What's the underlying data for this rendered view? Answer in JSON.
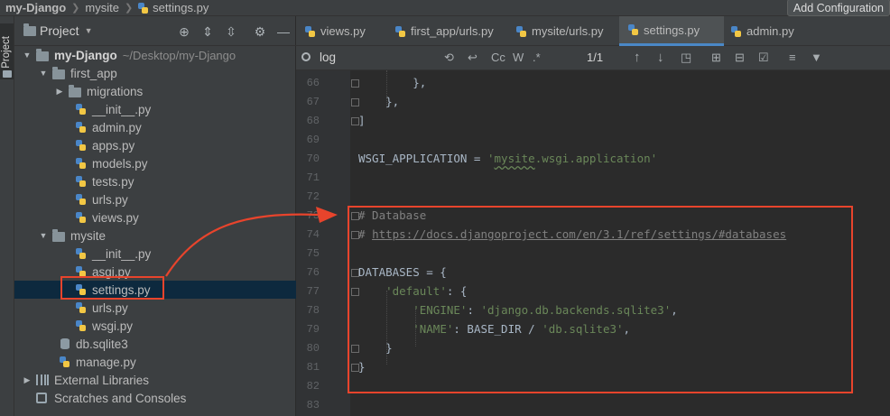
{
  "breadcrumbs": [
    {
      "label": "my-Django"
    },
    {
      "label": "mysite"
    },
    {
      "label": "settings.py"
    }
  ],
  "toolbar": {
    "add_configuration_label": "Add Configuration"
  },
  "tool_strip": {
    "project_label": "Project"
  },
  "project_panel": {
    "title": "Project",
    "root": {
      "name": "my-Django",
      "path": "~/Desktop/my-Django"
    },
    "tree": [
      {
        "label": "first_app",
        "kind": "folder",
        "depth": 1,
        "expanded": true
      },
      {
        "label": "migrations",
        "kind": "folder",
        "depth": 2,
        "expanded": false
      },
      {
        "label": "__init__.py",
        "kind": "py",
        "depth": 3
      },
      {
        "label": "admin.py",
        "kind": "py",
        "depth": 3
      },
      {
        "label": "apps.py",
        "kind": "py",
        "depth": 3
      },
      {
        "label": "models.py",
        "kind": "py",
        "depth": 3
      },
      {
        "label": "tests.py",
        "kind": "py",
        "depth": 3
      },
      {
        "label": "urls.py",
        "kind": "py",
        "depth": 3
      },
      {
        "label": "views.py",
        "kind": "py",
        "depth": 3
      },
      {
        "label": "mysite",
        "kind": "folder",
        "depth": 1,
        "expanded": true
      },
      {
        "label": "__init__.py",
        "kind": "py",
        "depth": 3
      },
      {
        "label": "asgi.py",
        "kind": "py",
        "depth": 3
      },
      {
        "label": "settings.py",
        "kind": "py",
        "depth": 3,
        "selected": true
      },
      {
        "label": "urls.py",
        "kind": "py",
        "depth": 3
      },
      {
        "label": "wsgi.py",
        "kind": "py",
        "depth": 3
      },
      {
        "label": "db.sqlite3",
        "kind": "db",
        "depth": 2
      },
      {
        "label": "manage.py",
        "kind": "py",
        "depth": 2
      },
      {
        "label": "External Libraries",
        "kind": "lib",
        "depth": 0,
        "expanded": false
      },
      {
        "label": "Scratches and Consoles",
        "kind": "scratch",
        "depth": 0
      }
    ]
  },
  "tabs": [
    {
      "label": "views.py"
    },
    {
      "label": "first_app/urls.py"
    },
    {
      "label": "mysite/urls.py"
    },
    {
      "label": "settings.py",
      "active": true
    },
    {
      "label": "admin.py"
    }
  ],
  "find_bar": {
    "query": "log",
    "match_count": "1/1",
    "match_case_label": "Cc",
    "words_label": "W",
    "regex_label": ".*"
  },
  "editor": {
    "lines": [
      {
        "num": "66",
        "text": "        },"
      },
      {
        "num": "67",
        "text": "    },"
      },
      {
        "num": "68",
        "text": "]"
      },
      {
        "num": "69",
        "text": ""
      },
      {
        "num": "70",
        "text": "WSGI_APPLICATION = 'mysite.wsgi.application'"
      },
      {
        "num": "71",
        "text": ""
      },
      {
        "num": "72",
        "text": ""
      },
      {
        "num": "73",
        "text": "# Database"
      },
      {
        "num": "74",
        "text": "# https://docs.djangoproject.com/en/3.1/ref/settings/#databases"
      },
      {
        "num": "75",
        "text": ""
      },
      {
        "num": "76",
        "text": "DATABASES = {"
      },
      {
        "num": "77",
        "text": "    'default': {"
      },
      {
        "num": "78",
        "text": "        'ENGINE': 'django.db.backends.sqlite3',"
      },
      {
        "num": "79",
        "text": "        'NAME': BASE_DIR / 'db.sqlite3',"
      },
      {
        "num": "80",
        "text": "    }"
      },
      {
        "num": "81",
        "text": "}"
      },
      {
        "num": "82",
        "text": ""
      },
      {
        "num": "83",
        "text": ""
      }
    ]
  },
  "colors": {
    "annotation_red": "#e8442c",
    "tab_accent": "#4a88c7",
    "selection": "#0d293e"
  }
}
